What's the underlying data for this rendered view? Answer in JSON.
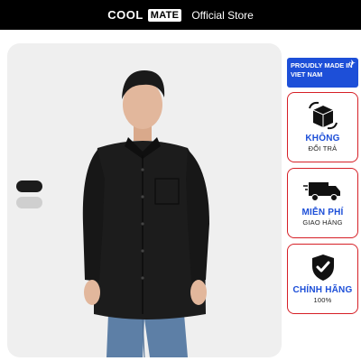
{
  "header": {
    "brand_cool": "COOL",
    "brand_mate": "MATE",
    "store": "Official Store"
  },
  "product": {
    "colors": [
      "#1b1b1b",
      "#cfcfcf"
    ]
  },
  "badge": {
    "line1": "PROUDLY MADE IN",
    "line2": "VIET NAM"
  },
  "features": [
    {
      "title": "KHÔNG",
      "subtitle": "ĐỔI TRẢ",
      "icon": "box-return-icon"
    },
    {
      "title": "MIỄN PHÍ",
      "subtitle": "GIAO HÀNG",
      "icon": "delivery-truck-icon"
    },
    {
      "title": "CHÍNH HÃNG",
      "subtitle": "100%",
      "icon": "shield-check-icon"
    }
  ],
  "colors": {
    "accent_blue": "#1d4fd8",
    "border_red": "#d61f26",
    "header_bg": "#000000"
  }
}
